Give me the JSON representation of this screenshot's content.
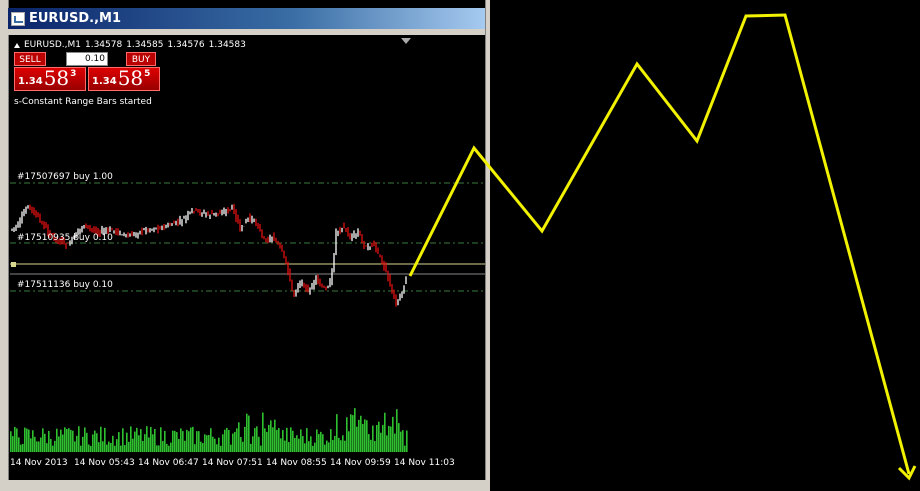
{
  "window": {
    "title": "EURUSD.,M1"
  },
  "header": {
    "symbol": "EURUSD.,M1",
    "ohlc": [
      "1.34578",
      "1.34585",
      "1.34576",
      "1.34583"
    ]
  },
  "trade": {
    "sell_label": "SELL",
    "buy_label": "BUY",
    "lot_value": "0.10",
    "sell_price": {
      "prefix": "1.34",
      "big": "58",
      "sup": "3"
    },
    "buy_price": {
      "prefix": "1.34",
      "big": "58",
      "sup": "5"
    }
  },
  "status_text": "s-Constant Range Bars started",
  "orders": [
    {
      "label": "#17507697 buy 1.00"
    },
    {
      "label": "#17510935 buy 0.10"
    },
    {
      "label": "#17511136 buy 0.10"
    }
  ],
  "time_axis": [
    "14 Nov 2013",
    "14 Nov 05:43",
    "14 Nov 06:47",
    "14 Nov 07:51",
    "14 Nov 08:55",
    "14 Nov 09:59",
    "14 Nov 11:03"
  ],
  "colors": {
    "bull": "#ffffff",
    "bear": "#e01010",
    "volume": "#2ec02e",
    "order_line": "#3c7a3c",
    "bid_line": "#d8d890",
    "annotation": "#f2f200",
    "title_bar": "#0a246a"
  },
  "icons": {
    "window": "chart-window-icon",
    "dropdown": "triangle-down-icon",
    "one_click": "triangle-up-icon"
  }
}
